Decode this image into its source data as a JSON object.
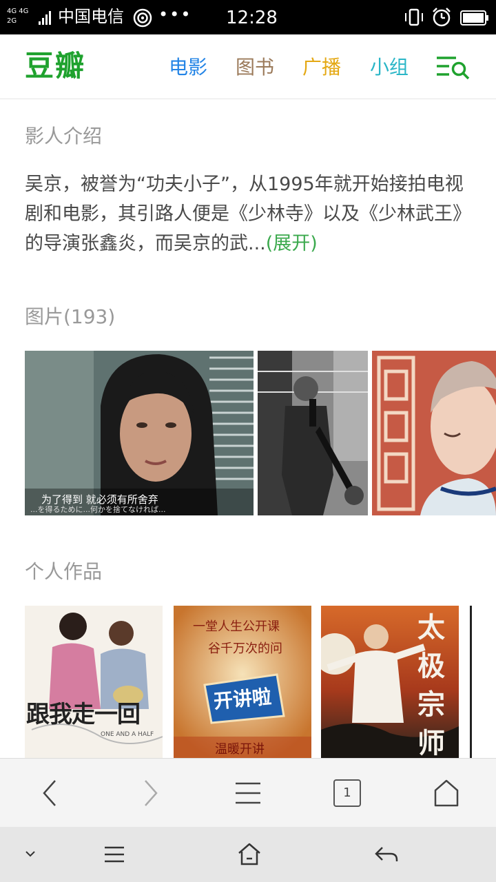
{
  "status_bar": {
    "signal_top": "4G 4G",
    "signal_bottom": "2G",
    "carrier": "中国电信",
    "more": "•••",
    "time": "12:28"
  },
  "header": {
    "logo": "豆瓣",
    "nav": [
      "电影",
      "图书",
      "广播",
      "小组"
    ],
    "nav_colors": [
      "#2384e6",
      "#9b7a5a",
      "#e4a813",
      "#2ab6c7"
    ],
    "brand_color": "#1fa22e"
  },
  "intro": {
    "title": "影人介绍",
    "text": "吴京，被誉为“功夫小子”，从1995年就开始接拍电视剧和电影，其引路人便是《少林寺》以及《少林武王》的导演张鑫炎，而吴京的武...",
    "expand": "(展开)"
  },
  "photos": {
    "title": "图片(193)",
    "items": [
      {
        "caption_cn": "为了得到 就必须有所舍弃",
        "caption_jp": "...を得るために...何かを捨てなければ..."
      },
      {
        "caption_cn": "",
        "caption_jp": ""
      },
      {
        "caption_cn": "",
        "caption_jp": ""
      }
    ]
  },
  "works": {
    "title": "个人作品",
    "items": [
      {
        "poster_title": "跟我走一回",
        "poster_sub": "ONE AND A HALF"
      },
      {
        "poster_title": "开讲啦",
        "poster_sub": "一堂人生公开课",
        "poster_sub2": "谷千万次的问",
        "poster_foot": "温暖开讲"
      },
      {
        "poster_title": "太极宗师",
        "poster_sub": ""
      }
    ]
  },
  "browser_toolbar": {
    "tabs_count": "1"
  },
  "icons": {
    "menu_search": "menu-search-icon",
    "back": "chevron-left-icon",
    "forward": "chevron-right-icon",
    "menu": "hamburger-icon",
    "home": "home-icon"
  }
}
